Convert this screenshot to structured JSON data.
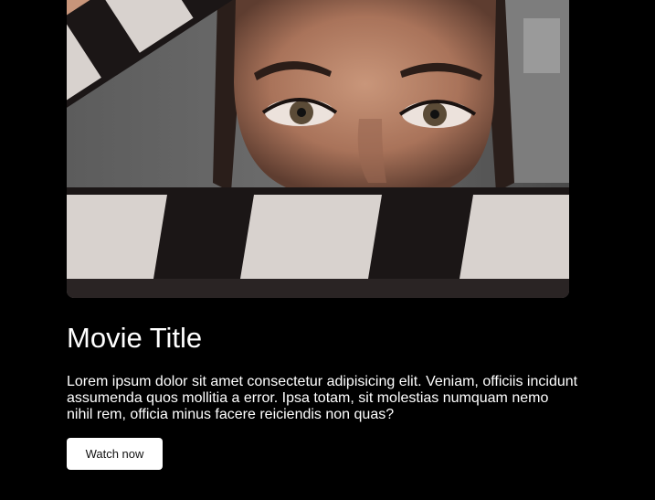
{
  "hero": {
    "image_icon": "clapperboard-portrait-photo"
  },
  "movie": {
    "title": "Movie Title",
    "description": "Lorem ipsum dolor sit amet consectetur adipisicing elit. Veniam, officiis incidunt assumenda quos mollitia a error. Ipsa totam, sit molestias numquam nemo nihil rem, officia minus facere reiciendis non quas?",
    "cta_label": "Watch now"
  },
  "colors": {
    "background": "#000000",
    "button_bg": "#ffffff",
    "text": "#ffffff"
  }
}
